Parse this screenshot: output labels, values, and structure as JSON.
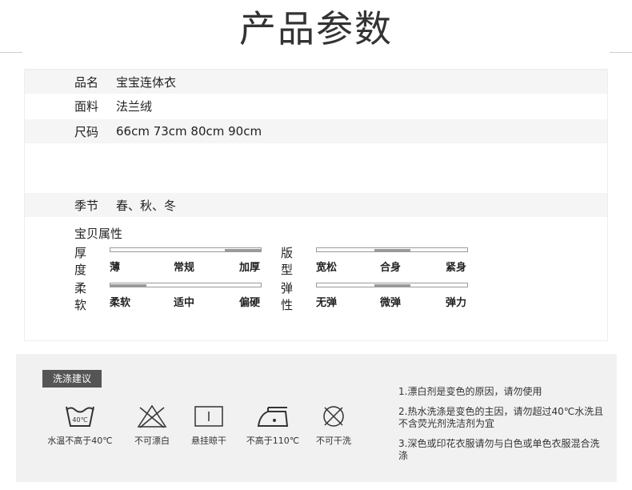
{
  "page_title": "产品参数",
  "params": [
    {
      "label": "品名",
      "value": "宝宝连体衣"
    },
    {
      "label": "面料",
      "value": "法兰绒"
    },
    {
      "label": "尺码",
      "value": "66cm 73cm 80cm 90cm"
    },
    {
      "label": "季节",
      "value": "春、秋、冬"
    }
  ],
  "attributes_title": "宝贝属性",
  "attributes": [
    {
      "name": "厚度",
      "options": [
        "薄",
        "常规",
        "加厚"
      ],
      "selected_index": 2
    },
    {
      "name": "版型",
      "options": [
        "宽松",
        "合身",
        "紧身"
      ],
      "selected_index": 1
    },
    {
      "name": "柔软",
      "options": [
        "柔软",
        "适中",
        "偏硬"
      ],
      "selected_index": 0
    },
    {
      "name": "弹性",
      "options": [
        "无弹",
        "微弹",
        "弹力"
      ],
      "selected_index": 1
    }
  ],
  "care": {
    "badge": "洗涤建议",
    "icons": [
      {
        "icon": "wash-40-icon",
        "label": "水温不高于40℃",
        "icon_text": "40℃"
      },
      {
        "icon": "no-bleach-icon",
        "label": "不可漂白"
      },
      {
        "icon": "hang-dry-icon",
        "label": "悬挂晾干"
      },
      {
        "icon": "iron-110-icon",
        "label": "不高于110℃"
      },
      {
        "icon": "no-dry-clean-icon",
        "label": "不可干洗"
      }
    ],
    "tips": [
      "1.漂白剂是变色的原因，请勿使用",
      "2.热水洗涤是变色的主因，请勿超过40℃水洗且不含荧光剂洗洁剂为宜",
      "3.深色或印花衣服请勿与白色或单色衣服混合洗涤"
    ]
  }
}
